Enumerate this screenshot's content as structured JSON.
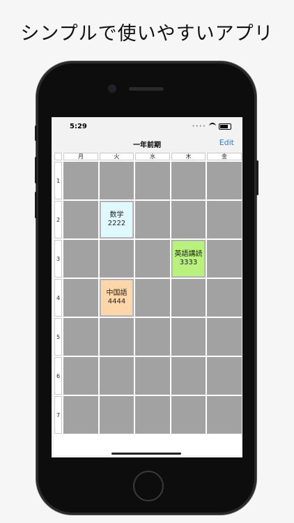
{
  "headline": "シンプルで使いやすいアプリ",
  "status": {
    "time": "5:29"
  },
  "nav": {
    "title": "一年前期",
    "edit_label": "Edit"
  },
  "days": [
    "月",
    "火",
    "水",
    "木",
    "金"
  ],
  "periods": [
    "1",
    "2",
    "3",
    "4",
    "5",
    "6",
    "7"
  ],
  "courses": [
    {
      "name": "数学",
      "code": "2222",
      "color": "#dffaff"
    },
    {
      "name": "英語講読",
      "code": "3333",
      "color": "#b8f27c"
    },
    {
      "name": "中国語",
      "code": "4444",
      "color": "#ffd6a8"
    }
  ],
  "colors": {
    "empty_cell": "#a2a2a2",
    "accent": "#2c7be5"
  }
}
